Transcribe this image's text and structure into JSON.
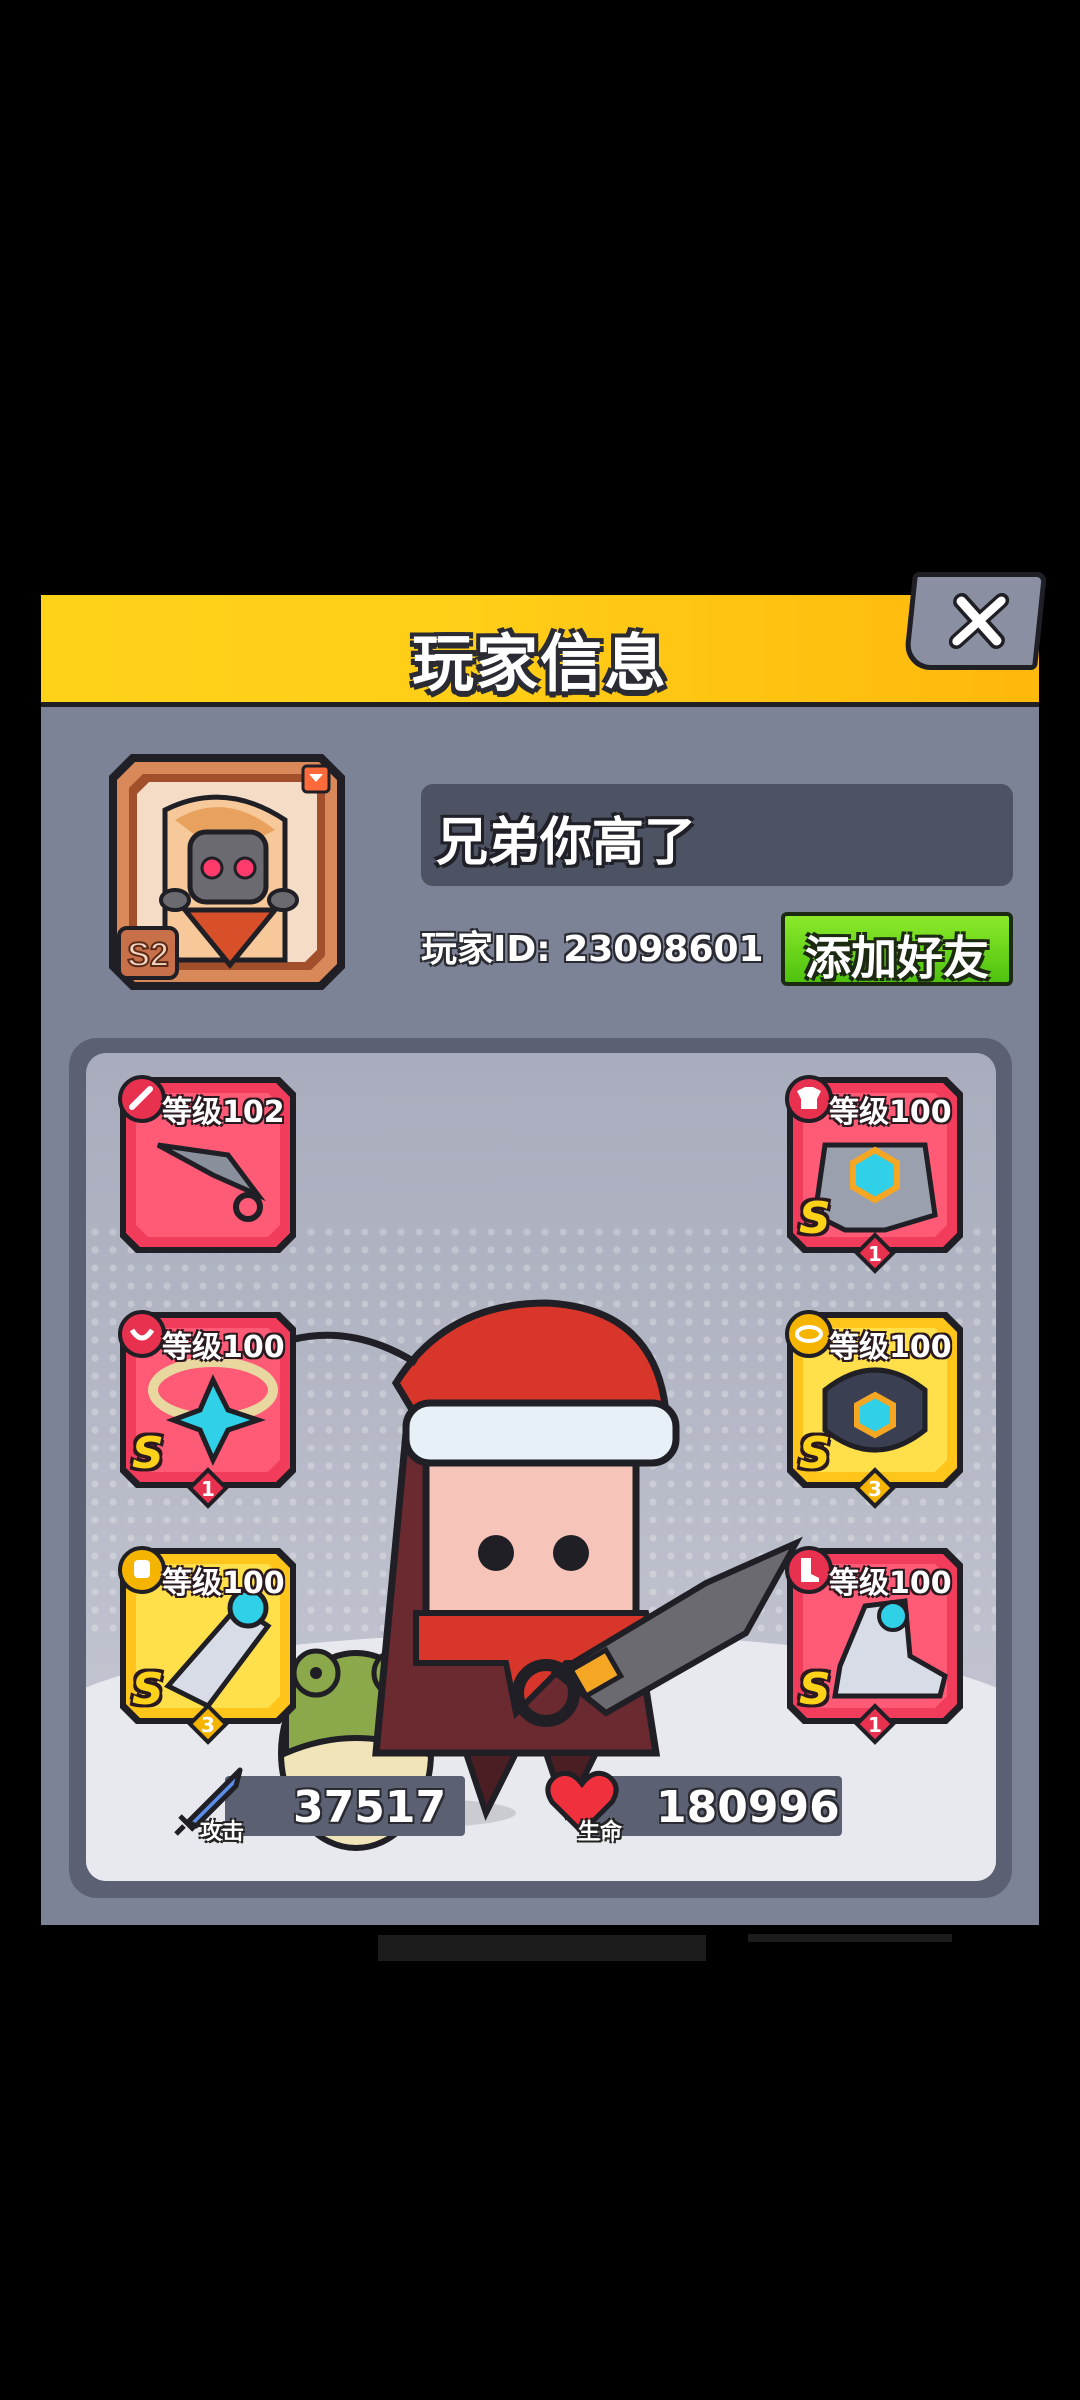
{
  "dialog": {
    "title": "玩家信息",
    "close_icon": "close-icon"
  },
  "player": {
    "season_badge": "S2",
    "name": "兄弟你高了",
    "id_text": "玩家ID: 23098601",
    "add_friend_label": "添加好友"
  },
  "equipment": {
    "left": [
      {
        "slot": "weapon",
        "level_label": "等级102",
        "rarity": "",
        "stars": "",
        "color": "red"
      },
      {
        "slot": "necklace",
        "level_label": "等级100",
        "rarity": "S",
        "stars": "1",
        "color": "red"
      },
      {
        "slot": "gloves",
        "level_label": "等级100",
        "rarity": "S",
        "stars": "3",
        "color": "gold"
      }
    ],
    "right": [
      {
        "slot": "armor",
        "level_label": "等级100",
        "rarity": "S",
        "stars": "1",
        "color": "red"
      },
      {
        "slot": "belt",
        "level_label": "等级100",
        "rarity": "S",
        "stars": "3",
        "color": "gold"
      },
      {
        "slot": "boots",
        "level_label": "等级100",
        "rarity": "S",
        "stars": "1",
        "color": "red"
      }
    ]
  },
  "stats": {
    "attack_label": "攻击",
    "attack_value": "37517",
    "hp_label": "生命",
    "hp_value": "180996"
  },
  "colors": {
    "header_yellow": "#ffd21a",
    "panel_gray": "#7c8396",
    "slot_red": "#f23c5c",
    "slot_gold": "#ffc51a",
    "button_green": "#5fd015"
  }
}
